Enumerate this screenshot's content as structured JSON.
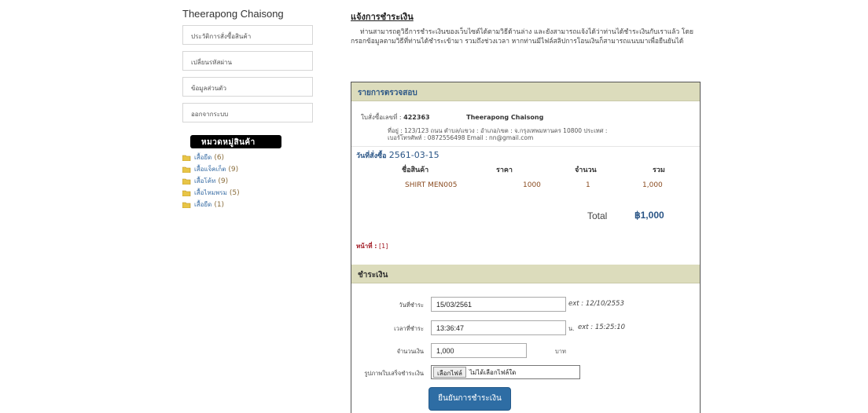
{
  "sidebar": {
    "user_name": "Theerapong Chaisong",
    "menu": [
      {
        "label": "ประวัติการสั่งซื้อสินค้า"
      },
      {
        "label": "เปลี่ยนรหัสผ่าน"
      },
      {
        "label": "ข้อมูลส่วนตัว"
      },
      {
        "label": "ออกจากระบบ"
      }
    ],
    "category_header": "หมวดหมู่สินค้า",
    "categories": [
      {
        "label": "เสื้อยืด",
        "count": "(6)"
      },
      {
        "label": "เสื้อแจ็คเก็ต",
        "count": "(9)"
      },
      {
        "label": "เสื้อโค้ท",
        "count": "(9)"
      },
      {
        "label": "เสื้อไหมพรม",
        "count": "(5)"
      },
      {
        "label": "เสื้อยืด",
        "count": "(1)"
      }
    ]
  },
  "main": {
    "title": "แจ้งการชำระเงิน",
    "intro": "ท่านสามารถดูวิธีการชำระเงินของเว็บไซต์ได้ตามวิธีด้านล่าง และยังสามารถแจ้งได้ว่าท่านได้ชำระเงินกับเราแล้ว โดยกรอกข้อมูลตามวิธีที่ท่านได้ชำระเข้ามา รวมถึงช่วงเวลา หากท่านมีไฟล์สลิปการโอนเงินก็สามารถแนบมาเพื่อยืนยันได้"
  },
  "review": {
    "header": "รายการตรวจสอบ",
    "order_label": "ใบสั่งซื้อเลขที่ :",
    "order_id": "422363",
    "customer_name": "Theerapong Chaisong",
    "address": "ที่อยู่ : 123/123 ถนน ตำบล/แขวง : อำเภอ/เขต : จ.กรุงเทพมหานคร 10800 ประเทศ :",
    "contact": "เบอร์โทรศัพท์ : 0872556498 Email : nn@gmail.com",
    "date_label": "วันที่สั่งซื้อ",
    "date_value": "2561-03-15",
    "columns": [
      "ชื่อสินค้า",
      "ราคา",
      "จำนวน",
      "รวม"
    ],
    "items": [
      {
        "name": "SHIRT MEN005",
        "price": "1000",
        "qty": "1",
        "total": "1,000"
      }
    ],
    "total_label": "Total",
    "total_value": "฿1,000",
    "page_label": "หน้าที่ :",
    "page_num": "[1]"
  },
  "payment": {
    "header": "ชำระเงิน",
    "date_label": "วันที่ชำระ",
    "date_value": "15/03/2561",
    "date_hint": "ext : 12/10/2553",
    "time_label": "เวลาที่ชำระ",
    "time_value": "13:36:47",
    "time_unit": "น.",
    "time_hint": "ext : 15:25:10",
    "amount_label": "จำนวนเงิน",
    "amount_value": "1,000",
    "amount_unit": "บาท",
    "file_label": "รูปภาพใบเสร็จชำระเงิน",
    "file_button": "เลือกไฟล์",
    "file_status": "ไม่ได้เลือกไฟล์ใด",
    "submit": "ยืนยันการชำระเงิน"
  },
  "colors": {
    "accent_blue": "#2e6da4",
    "section_header_bg": "#dcdcbc",
    "price_text": "#8a4b20",
    "paging_red": "#a0151f"
  }
}
